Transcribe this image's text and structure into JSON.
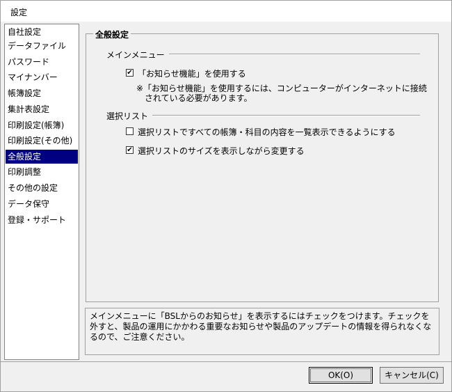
{
  "window": {
    "title": "設定"
  },
  "sidebar": {
    "items": [
      {
        "label": "自社設定"
      },
      {
        "label": "データファイル"
      },
      {
        "label": "パスワード"
      },
      {
        "label": "マイナンバー"
      },
      {
        "label": "帳簿設定"
      },
      {
        "label": "集計表設定"
      },
      {
        "label": "印刷設定(帳簿)"
      },
      {
        "label": "印刷設定(その他)"
      },
      {
        "label": "全般設定",
        "selected": true
      },
      {
        "label": "印刷調整"
      },
      {
        "label": "その他の設定"
      },
      {
        "label": "データ保守"
      },
      {
        "label": "登録・サポート"
      }
    ]
  },
  "main": {
    "group_title": "全般設定",
    "menu_section": {
      "label": "メインメニュー",
      "checkbox_label": "「お知らせ機能」を使用する",
      "checked": true,
      "note_line1": "※「お知らせ機能」を使用するには、コンピューターがインターネットに接続",
      "note_line2": "されている必要があります。"
    },
    "select_section": {
      "label": "選択リスト",
      "option1_label": "選択リストですべての帳簿・科目の内容を一覧表示できるようにする",
      "option1_checked": false,
      "option2_label": "選択リストのサイズを表示しながら変更する",
      "option2_checked": true
    }
  },
  "description": {
    "text": "メインメニューに「BSLからのお知らせ」を表示するにはチェックをつけます。チェックを外すと、製品の運用にかかわる重要なお知らせや製品のアップデートの情報を得られなくなるので、ご注意ください。"
  },
  "footer": {
    "ok_label": "OK(O)",
    "cancel_label": "キャンセル(C)"
  }
}
